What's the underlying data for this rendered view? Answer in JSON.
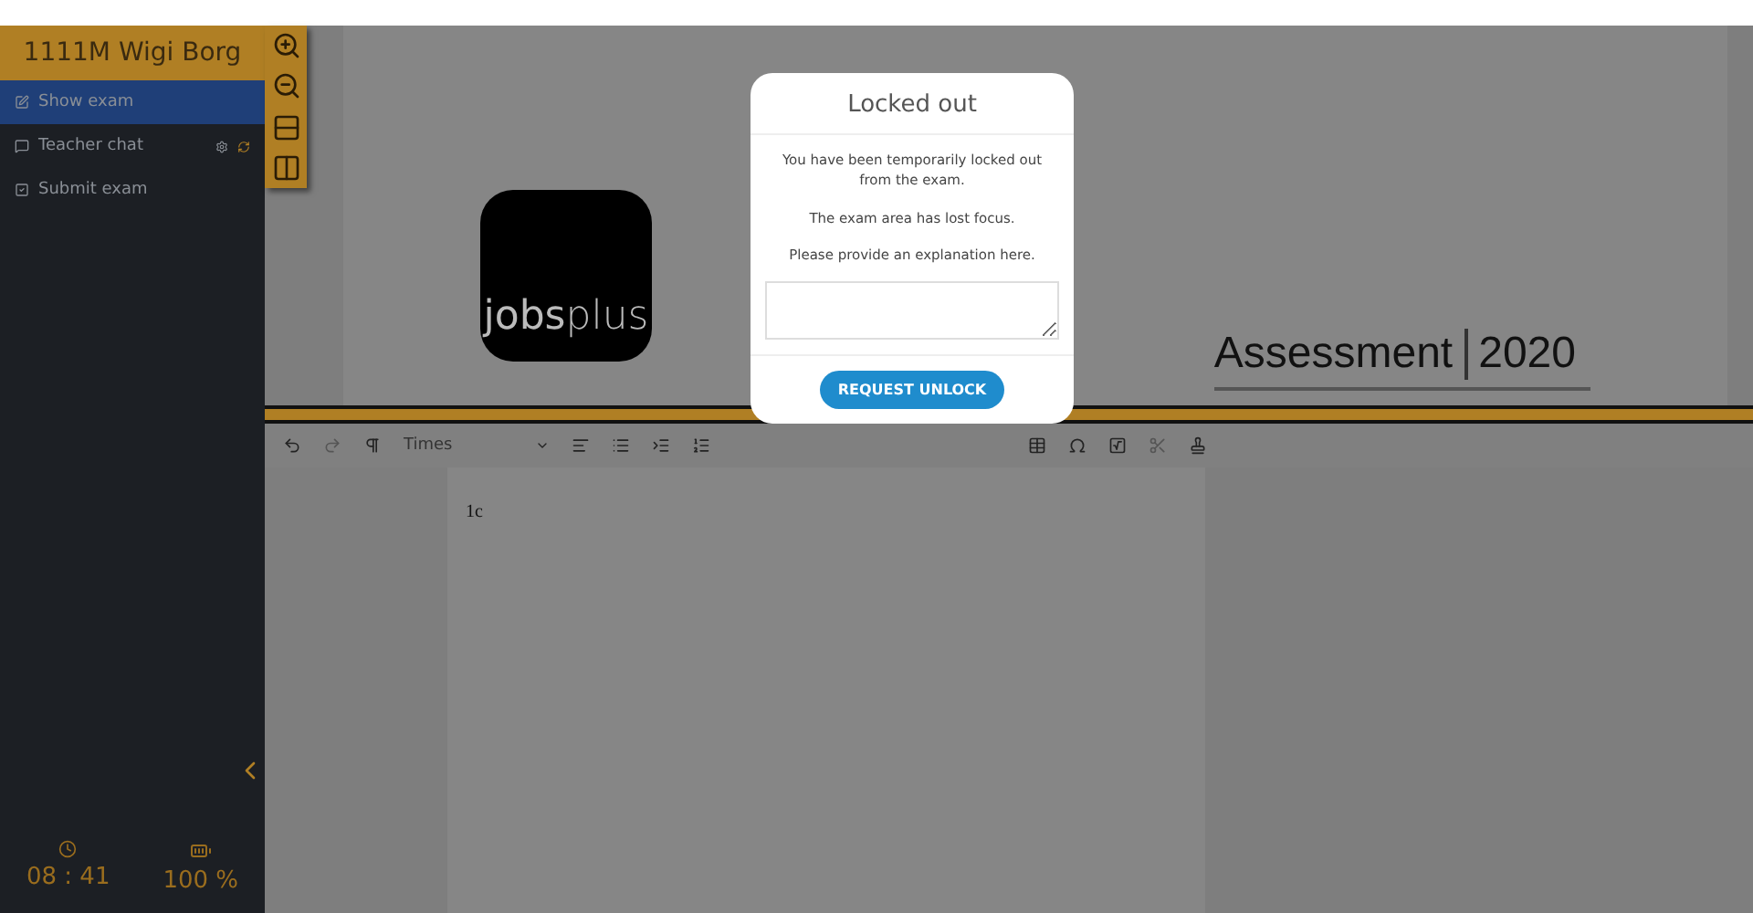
{
  "sidebar": {
    "user": "1111M Wigi Borg",
    "items": [
      {
        "label": "Show exam",
        "kind": "edit",
        "selected": true
      },
      {
        "label": "Teacher chat",
        "kind": "chat",
        "selected": false
      },
      {
        "label": "Submit exam",
        "kind": "check",
        "selected": false
      }
    ],
    "time": "08 : 41",
    "battery": "100 %"
  },
  "exam": {
    "logo": "**jobs**plus",
    "title": "Assessment",
    "year": "2020"
  },
  "editor": {
    "font": "Times",
    "text": "1c"
  },
  "dialog": {
    "title": "Locked out",
    "messages": [
      "You have been temporarily locked out from the exam.",
      "The exam area has lost focus.",
      "Please provide an explanation here."
    ],
    "button": "REQUEST UNLOCK"
  }
}
